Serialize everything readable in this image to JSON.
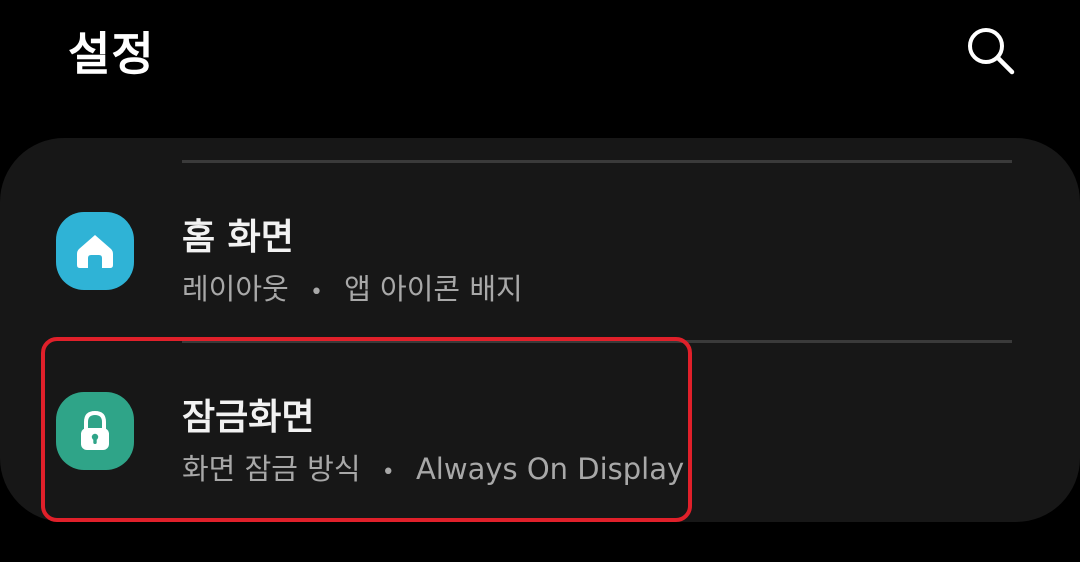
{
  "header": {
    "title": "설정",
    "search_icon": "search-icon"
  },
  "settings": {
    "items": [
      {
        "title": "홈 화면",
        "subtitle_parts": [
          "레이아웃",
          "앱 아이콘 배지"
        ],
        "icon": "home-icon",
        "icon_color": "#2fb3d6"
      },
      {
        "title": "잠금화면",
        "subtitle_parts": [
          "화면 잠금 방식",
          "Always On Display"
        ],
        "icon": "lock-icon",
        "icon_color": "#2fa488"
      }
    ],
    "separator": "•"
  },
  "colors": {
    "background": "#000000",
    "card": "#171717",
    "highlight": "#e0202a"
  }
}
